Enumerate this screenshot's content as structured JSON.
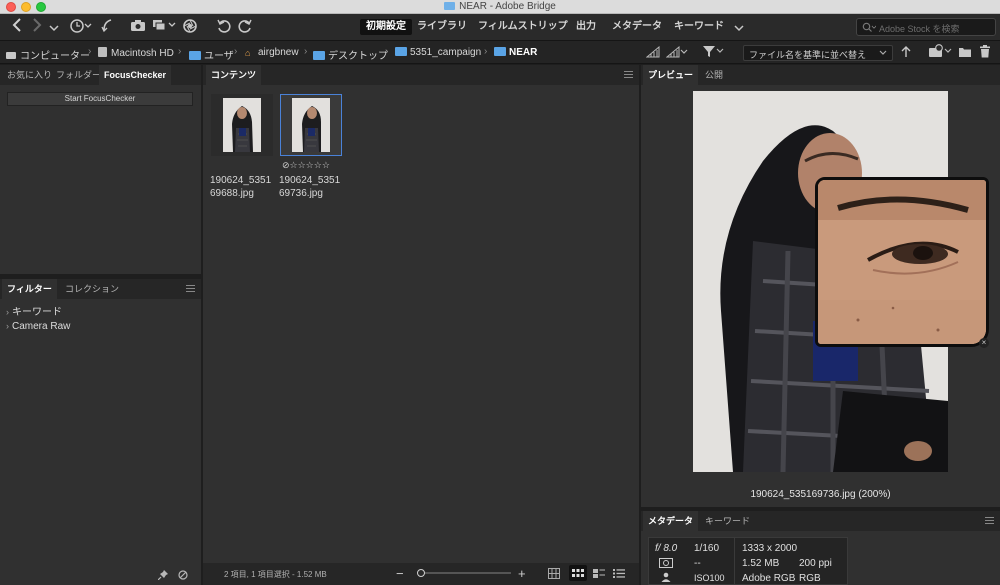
{
  "window": {
    "title": "NEAR - Adobe Bridge"
  },
  "workspaces": [
    {
      "label": "初期設定",
      "active": true
    },
    {
      "label": "ライブラリ",
      "active": false
    },
    {
      "label": "フィルムストリップ",
      "active": false
    },
    {
      "label": "出力",
      "active": false
    },
    {
      "label": "メタデータ",
      "active": false
    },
    {
      "label": "キーワード",
      "active": false
    }
  ],
  "search": {
    "placeholder": "Adobe Stock を検索"
  },
  "breadcrumb": [
    {
      "label": "コンピューター",
      "icon": "computer-icon"
    },
    {
      "label": "Macintosh HD",
      "icon": "hard-drive-icon"
    },
    {
      "label": "ユーザ",
      "icon": "folder-icon"
    },
    {
      "label": "airgbnew",
      "icon": "home-icon"
    },
    {
      "label": "デスクトップ",
      "icon": "folder-icon"
    },
    {
      "label": "5351_campaign",
      "icon": "folder-icon"
    },
    {
      "label": "NEAR",
      "icon": "folder-icon"
    }
  ],
  "sort": {
    "value": "ファイル名を基準に並べ替え"
  },
  "left_top_panel": {
    "tabs": [
      "お気に入り",
      "フォルダー",
      "FocusChecker"
    ],
    "active_tab": "FocusChecker",
    "start_button": "Start FocusChecker"
  },
  "left_bottom_panel": {
    "tabs": [
      "フィルター",
      "コレクション"
    ],
    "active_tab": "フィルター",
    "items": [
      "キーワード",
      "Camera Raw"
    ]
  },
  "content_panel": {
    "tab": "コンテンツ",
    "items": [
      {
        "name_line1": "190624_5351",
        "name_line2": "69688.jpg",
        "selected": false
      },
      {
        "name_line1": "190624_5351",
        "name_line2": "69736.jpg",
        "selected": true,
        "rating": "⊘☆☆☆☆☆"
      }
    ],
    "status": "2 項目, 1 項目選択 - 1.52 MB"
  },
  "preview_panel": {
    "tabs": [
      "プレビュー",
      "公開"
    ],
    "active_tab": "プレビュー",
    "caption": "190624_535169736.jpg (200%)"
  },
  "metadata_panel": {
    "tabs": [
      "メタデータ",
      "キーワード"
    ],
    "active_tab": "メタデータ",
    "aperture": "f/ 8.0",
    "shutter": "1/160",
    "dimensions": "1333 x 2000",
    "metering": "--",
    "filesize": "1.52 MB",
    "resolution": "200 ppi",
    "iso": "ISO100",
    "colorprofile": "Adobe RGB",
    "colormode": "RGB"
  },
  "colors": {
    "accent_selection": "#4a82d8",
    "folder_blue": "#5aa4e6",
    "panel_bg": "#303030",
    "header_bg": "#262626"
  }
}
